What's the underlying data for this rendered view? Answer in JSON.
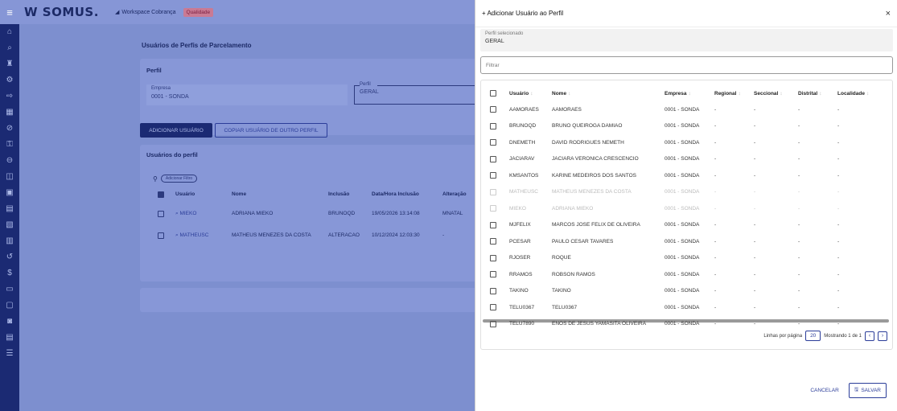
{
  "topbar": {
    "logo": "W SOMUS.",
    "workspace": "Workspace Cobrança",
    "workspace_tag": "Qualidade"
  },
  "main": {
    "title": "Usuários de Perfis de Parcelamento",
    "perfil_title": "Perfil",
    "empresa_label": "Empresa",
    "empresa_value": "0001 - SONDA",
    "perfil_label": "Perfil",
    "perfil_value": "GERAL",
    "btn_add": "ADICIONAR USUÁRIO",
    "btn_copy": "COPIAR USUÁRIO DE OUTRO PERFIL",
    "users_title": "Usuários do perfil",
    "filter_btn": "Adicionar Filtro",
    "headers": [
      "Usuário",
      "Nome",
      "Inclusão",
      "Data/Hora Inclusão",
      "Alteração"
    ],
    "rows": [
      [
        "MIEKO",
        "ADRIANA MIEKO",
        "BRUNOQD",
        "19/05/2026 13:14:08",
        "MNATAL"
      ],
      [
        "MATHEUSC",
        "MATHEUS MENEZES DA COSTA",
        "ALTERACAO",
        "10/12/2024 12:03:30",
        "-"
      ]
    ]
  },
  "modal": {
    "title": "Adicionar Usuário ao Perfil",
    "close": "×",
    "perfil_sel_label": "Perfil selecionado",
    "perfil_sel_value": "GERAL",
    "filter_placeholder": "Filtrar",
    "headers": [
      "Usuário",
      "Nome",
      "Empresa",
      "Regional",
      "Seccional",
      "Distrital",
      "Localidade"
    ],
    "rows": [
      {
        "u": "AAMORAES",
        "n": "AAMORAES",
        "e": "0001 - SONDA",
        "dim": false
      },
      {
        "u": "BRUNOQD",
        "n": "BRUNO QUEIROGA DAMIAO",
        "e": "0001 - SONDA",
        "dim": false
      },
      {
        "u": "DNEMETH",
        "n": "DAVID RODRIGUES NEMETH",
        "e": "0001 - SONDA",
        "dim": false
      },
      {
        "u": "JACIARAV",
        "n": "JACIARA VERONICA CRESCENCIO",
        "e": "0001 - SONDA",
        "dim": false
      },
      {
        "u": "KMSANTOS",
        "n": "KARINE MEDEIROS DOS SANTOS",
        "e": "0001 - SONDA",
        "dim": false
      },
      {
        "u": "MATHEUSC",
        "n": "MATHEUS MENEZES DA COSTA",
        "e": "0001 - SONDA",
        "dim": true
      },
      {
        "u": "MIEKO",
        "n": "ADRIANA MIEKO",
        "e": "0001 - SONDA",
        "dim": true
      },
      {
        "u": "MJFELIX",
        "n": "MARCOS JOSE FELIX DE OLIVEIRA",
        "e": "0001 - SONDA",
        "dim": false
      },
      {
        "u": "PCESAR",
        "n": "PAULO CESAR TAVARES",
        "e": "0001 - SONDA",
        "dim": false
      },
      {
        "u": "RJOSER",
        "n": "ROQUE",
        "e": "0001 - SONDA",
        "dim": false
      },
      {
        "u": "RRAMOS",
        "n": "ROBSON RAMOS",
        "e": "0001 - SONDA",
        "dim": false
      },
      {
        "u": "TAKINO",
        "n": "TAKINO",
        "e": "0001 - SONDA",
        "dim": false
      },
      {
        "u": "TELU0367",
        "n": "TELU0367",
        "e": "0001 - SONDA",
        "dim": false
      },
      {
        "u": "TELU7890",
        "n": "ENOS DE JESUS YAMASITA OLIVEIRA",
        "e": "0001 - SONDA",
        "dim": false
      }
    ],
    "dash": "-",
    "rows_per_page_label": "Linhas por página",
    "rows_per_page": "20",
    "showing": "Mostrando 1 de 1",
    "prev": "‹",
    "next": "›",
    "cancel": "CANCELAR",
    "save": "SALVAR"
  }
}
